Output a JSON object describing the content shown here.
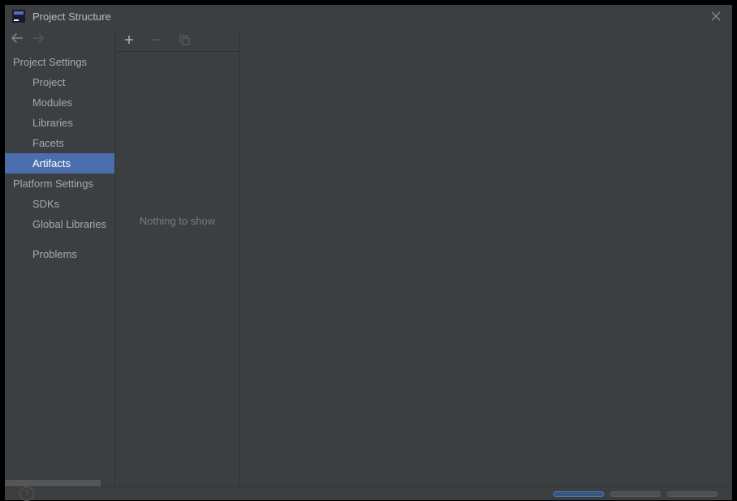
{
  "window": {
    "title": "Project Structure"
  },
  "sidebar": {
    "sections": [
      {
        "header": "Project Settings",
        "items": [
          {
            "label": "Project",
            "id": "project"
          },
          {
            "label": "Modules",
            "id": "modules"
          },
          {
            "label": "Libraries",
            "id": "libraries"
          },
          {
            "label": "Facets",
            "id": "facets"
          },
          {
            "label": "Artifacts",
            "id": "artifacts",
            "selected": true
          }
        ]
      },
      {
        "header": "Platform Settings",
        "items": [
          {
            "label": "SDKs",
            "id": "sdks"
          },
          {
            "label": "Global Libraries",
            "id": "global-libraries"
          }
        ]
      },
      {
        "header": null,
        "items": [
          {
            "label": "Problems",
            "id": "problems"
          }
        ]
      }
    ]
  },
  "nav": {
    "back_enabled": true,
    "forward_enabled": false
  },
  "toolbar": {
    "add_enabled": true,
    "remove_enabled": false,
    "copy_enabled": false
  },
  "list": {
    "empty_text": "Nothing to show"
  },
  "footer": {
    "buttons": [
      {
        "label": "",
        "primary": true
      },
      {
        "label": "",
        "primary": false
      },
      {
        "label": "",
        "primary": false
      }
    ]
  }
}
